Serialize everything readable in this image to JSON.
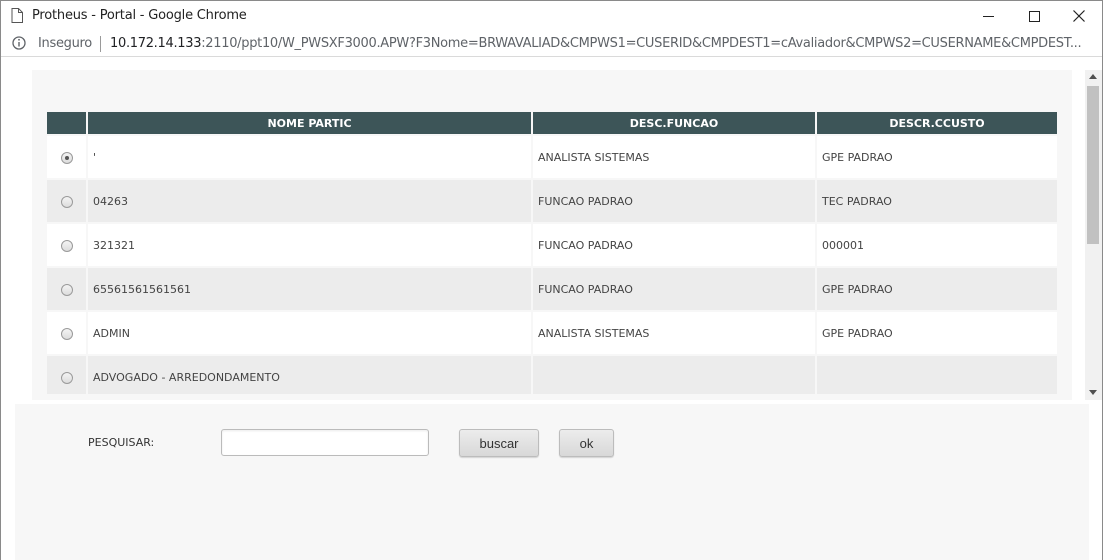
{
  "window": {
    "title": "Protheus - Portal - Google Chrome",
    "controls": [
      "minimize-icon",
      "maximize-icon",
      "close-icon"
    ]
  },
  "addressbar": {
    "security_label": "Inseguro",
    "url_host": "10.172.14.133",
    "url_rest": ":2110/ppt10/W_PWSXF3000.APW?F3Nome=BRWAVALIAD&CMPWS1=CUSERID&CMPDEST1=cAvaliador&CMPWS2=CUSERNAME&CMPDEST..."
  },
  "grid": {
    "columns": [
      "",
      "NOME PARTIC",
      "DESC.FUNCAO",
      "DESCR.CCUSTO"
    ],
    "rows": [
      {
        "selected": true,
        "nome": "'",
        "funcao": "ANALISTA SISTEMAS",
        "ccusto": "GPE PADRAO"
      },
      {
        "selected": false,
        "nome": "04263",
        "funcao": "FUNCAO PADRAO",
        "ccusto": "TEC PADRAO"
      },
      {
        "selected": false,
        "nome": "321321",
        "funcao": "FUNCAO PADRAO",
        "ccusto": "000001"
      },
      {
        "selected": false,
        "nome": "65561561561561",
        "funcao": "FUNCAO PADRAO",
        "ccusto": "GPE PADRAO"
      },
      {
        "selected": false,
        "nome": "ADMIN",
        "funcao": "ANALISTA SISTEMAS",
        "ccusto": "GPE PADRAO"
      },
      {
        "selected": false,
        "nome": "ADVOGADO - ARREDONDAMENTO",
        "funcao": "",
        "ccusto": ""
      }
    ]
  },
  "search": {
    "label": "PESQUISAR:",
    "value": "",
    "buscar_label": "buscar",
    "ok_label": "ok"
  },
  "colors": {
    "header_bg": "#3d5558",
    "row_alt_bg": "#ececec",
    "panel_bg": "#f7f7f7"
  }
}
